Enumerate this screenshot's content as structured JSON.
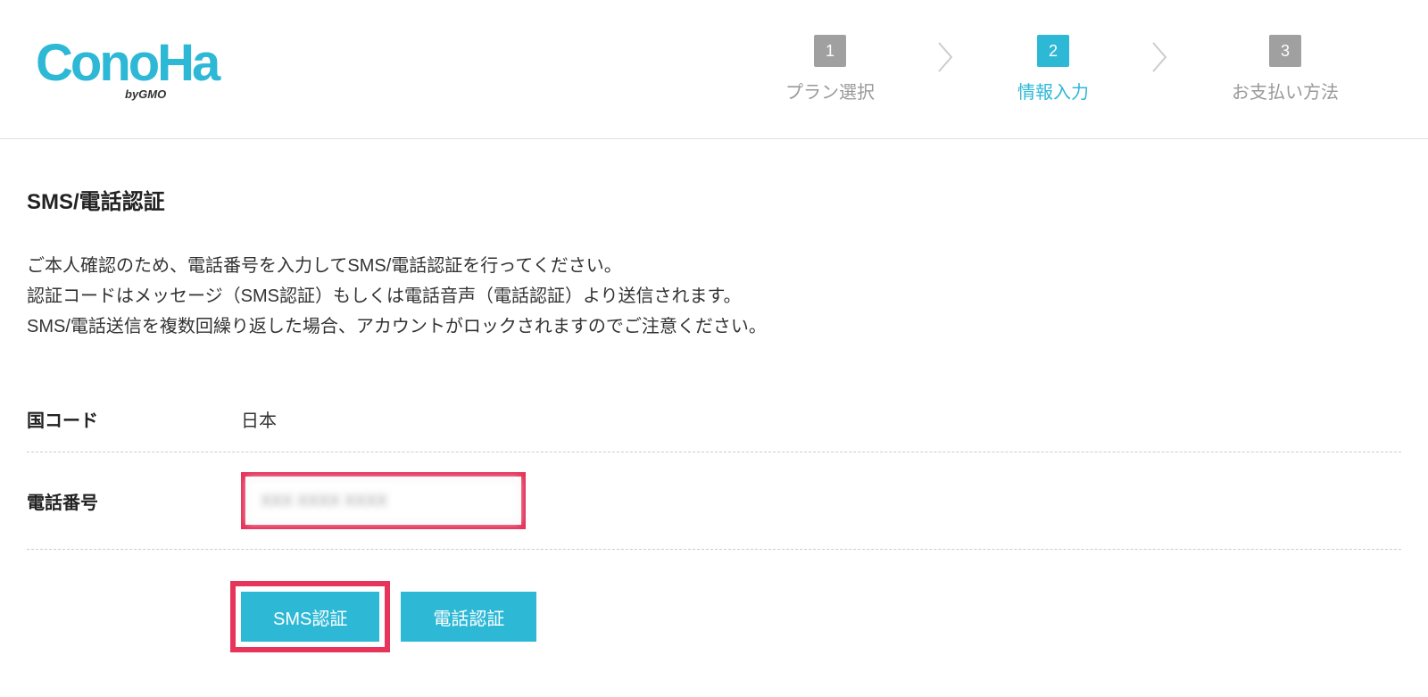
{
  "logo": {
    "main": "ConoHa",
    "sub": "byGMO"
  },
  "steps": {
    "items": [
      {
        "number": "1",
        "label": "プラン選択",
        "active": false
      },
      {
        "number": "2",
        "label": "情報入力",
        "active": true
      },
      {
        "number": "3",
        "label": "お支払い方法",
        "active": false
      }
    ]
  },
  "page": {
    "title": "SMS/電話認証",
    "description_line1": "ご本人確認のため、電話番号を入力してSMS/電話認証を行ってください。",
    "description_line2": "認証コードはメッセージ（SMS認証）もしくは電話音声（電話認証）より送信されます。",
    "description_line3": "SMS/電話送信を複数回繰り返した場合、アカウントがロックされますのでご注意ください。"
  },
  "form": {
    "country_label": "国コード",
    "country_value": "日本",
    "phone_label": "電話番号",
    "phone_value": "XXX XXXX XXXX"
  },
  "buttons": {
    "sms_auth": "SMS認証",
    "phone_auth": "電話認証"
  }
}
